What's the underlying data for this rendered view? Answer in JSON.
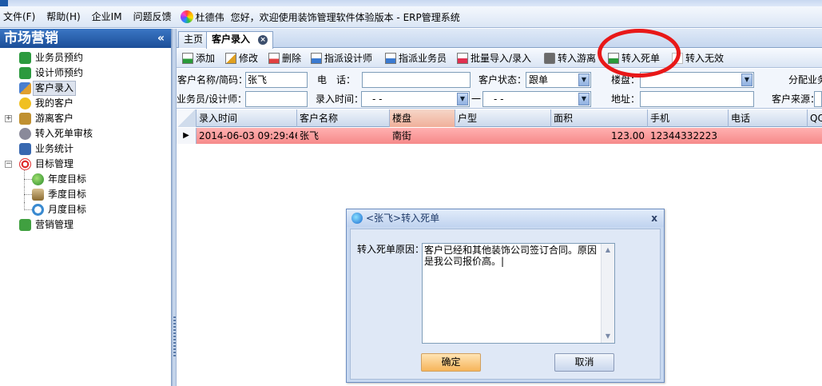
{
  "menu": {
    "file": "文件(F)",
    "help": "帮助(H)",
    "im": "企业IM",
    "feedback": "问题反馈",
    "user_name": "杜德伟",
    "welcome": "您好，欢迎使用装饰管理软件体验版本 - ERP管理系统"
  },
  "sidebar": {
    "title": "市场营销",
    "collapse": "«",
    "items": [
      {
        "label": "业务员预约"
      },
      {
        "label": "设计师预约"
      },
      {
        "label": "客户录入"
      },
      {
        "label": "我的客户"
      },
      {
        "label": "游离客户"
      },
      {
        "label": "转入死单审核"
      },
      {
        "label": "业务统计"
      },
      {
        "label": "目标管理"
      },
      {
        "label": "年度目标"
      },
      {
        "label": "季度目标"
      },
      {
        "label": "月度目标"
      },
      {
        "label": "营销管理"
      }
    ]
  },
  "tabs": [
    {
      "label": "主页"
    },
    {
      "label": "客户录入"
    }
  ],
  "toolbar": {
    "add": "添加",
    "edit": "修改",
    "delete": "删除",
    "assign_designer": "指派设计师",
    "assign_sales": "指派业务员",
    "batch_import": "批量导入/录入",
    "to_free": "转入游离",
    "to_dead": "转入死单",
    "to_invalid": "转入无效"
  },
  "filter": {
    "name_label": "客户名称/简码：",
    "name_value": "张飞",
    "phone_label": "电　话：",
    "phone_value": "",
    "status_label": "客户状态：",
    "status_value": "跟单",
    "building_label": "楼盘：",
    "building_value": "",
    "assign_label": "分配业务",
    "staff_label": "业务员/设计师：",
    "staff_value": "",
    "time_label": "录入时间：",
    "time_from": "-  -",
    "time_sep": "一",
    "time_to": "-  -",
    "address_label": "地址：",
    "address_value": "",
    "source_label": "客户来源："
  },
  "grid": {
    "headers": [
      "录入时间",
      "客户名称",
      "楼盘",
      "户型",
      "面积",
      "手机",
      "电话",
      "QQ"
    ],
    "rows": [
      {
        "time": "2014-06-03 09:29:46",
        "name": "张飞",
        "building": "南街",
        "type": "",
        "area": "123.00",
        "mobile": "12344332223",
        "phone": "",
        "qq": ""
      }
    ]
  },
  "dialog": {
    "title": "<张飞>转入死单",
    "close": "x",
    "reason_label": "转入死单原因：",
    "reason_value": "客户已经和其他装饰公司签订合同。原因是我公司报价高。|",
    "ok": "确定",
    "cancel": "取消"
  },
  "colors": {
    "selected_row": "#f68a8a",
    "header_blue": "#1c4e98",
    "annotation_red": "#e81818"
  }
}
